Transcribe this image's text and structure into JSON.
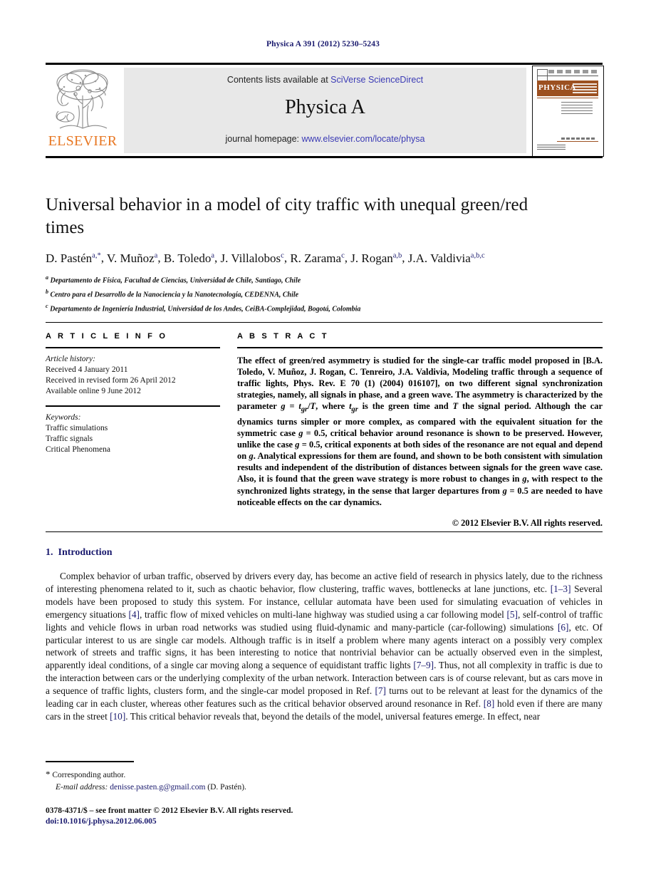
{
  "running_head": "Physica A 391 (2012) 5230–5243",
  "masthead": {
    "contents_prefix": "Contents lists available at ",
    "sciencedirect": "SciVerse ScienceDirect",
    "journal_name": "Physica A",
    "homepage_prefix": "journal homepage: ",
    "homepage_url": "www.elsevier.com/locate/physa",
    "publisher": "ELSEVIER",
    "cover_banner": "PHYSICA",
    "accent_orange": "#E87722",
    "link_blue": "#3b3bb5",
    "cover_band": "#9c5020"
  },
  "article": {
    "title": "Universal behavior in a model of city traffic with unequal green/red times",
    "authors": [
      {
        "name": "D. Pastén",
        "sup": "a,*"
      },
      {
        "name": "V. Muñoz",
        "sup": "a"
      },
      {
        "name": "B. Toledo",
        "sup": "a"
      },
      {
        "name": "J. Villalobos",
        "sup": "c"
      },
      {
        "name": "R. Zarama",
        "sup": "c"
      },
      {
        "name": "J. Rogan",
        "sup": "a,b"
      },
      {
        "name": "J.A. Valdivia",
        "sup": "a,b,c"
      }
    ],
    "affiliations": [
      {
        "mark": "a",
        "text": "Departamento de Física, Facultad de Ciencias, Universidad de Chile, Santiago, Chile"
      },
      {
        "mark": "b",
        "text": "Centro para el Desarrollo de la Nanociencia y la Nanotecnología, CEDENNA, Chile"
      },
      {
        "mark": "c",
        "text": "Departamento de Ingeniería Industrial, Universidad de los Andes, CeiBA-Complejidad, Bogotá, Colombia"
      }
    ]
  },
  "article_info": {
    "heading": "A R T I C L E   I N F O",
    "history_label": "Article history:",
    "history": [
      "Received 4 January 2011",
      "Received in revised form 26 April 2012",
      "Available online 9 June 2012"
    ],
    "keywords_label": "Keywords:",
    "keywords": [
      "Traffic simulations",
      "Traffic signals",
      "Critical Phenomena"
    ]
  },
  "abstract": {
    "heading": "A B S T R A C T",
    "text": "The effect of green/red asymmetry is studied for the single-car traffic model proposed in [B.A. Toledo, V. Muñoz, J. Rogan, C. Tenreiro, J.A. Valdivia, Modeling traffic through a sequence of traffic lights, Phys. Rev. E 70 (1) (2004) 016107], on two different signal synchronization strategies, namely, all signals in phase, and a green wave. The asymmetry is characterized by the parameter g = tgr/T, where tgr is the green time and T the signal period. Although the car dynamics turns simpler or more complex, as compared with the equivalent situation for the symmetric case g = 0.5, critical behavior around resonance is shown to be preserved. However, unlike the case g = 0.5, critical exponents at both sides of the resonance are not equal and depend on g. Analytical expressions for them are found, and shown to be both consistent with simulation results and independent of the distribution of distances between signals for the green wave case. Also, it is found that the green wave strategy is more robust to changes in g, with respect to the synchronized lights strategy, in the sense that larger departures from g = 0.5 are needed to have noticeable effects on the car dynamics.",
    "copyright": "© 2012 Elsevier B.V. All rights reserved."
  },
  "section": {
    "number": "1.",
    "title": "Introduction",
    "paragraph": "Complex behavior of urban traffic, observed by drivers every day, has become an active field of research in physics lately, due to the richness of interesting phenomena related to it, such as chaotic behavior, flow clustering, traffic waves, bottlenecks at lane junctions, etc. [1–3] Several models have been proposed to study this system. For instance, cellular automata have been used for simulating evacuation of vehicles in emergency situations [4], traffic flow of mixed vehicles on multi-lane highway was studied using a car following model [5], self-control of traffic lights and vehicle flows in urban road networks was studied using fluid-dynamic and many-particle (car-following) simulations [6], etc. Of particular interest to us are single car models. Although traffic is in itself a problem where many agents interact on a possibly very complex network of streets and traffic signs, it has been interesting to notice that nontrivial behavior can be actually observed even in the simplest, apparently ideal conditions, of a single car moving along a sequence of equidistant traffic lights [7–9]. Thus, not all complexity in traffic is due to the interaction between cars or the underlying complexity of the urban network. Interaction between cars is of course relevant, but as cars move in a sequence of traffic lights, clusters form, and the single-car model proposed in Ref. [7] turns out to be relevant at least for the dynamics of the leading car in each cluster, whereas other features such as the critical behavior observed around resonance in Ref. [8] hold even if there are many cars in the street [10]. This critical behavior reveals that, beyond the details of the model, universal features emerge. In effect, near"
  },
  "footer": {
    "corresponding_marker": "*",
    "corresponding_text": "Corresponding author.",
    "email_label": "E-mail address:",
    "email": "denisse.pasten.g@gmail.com",
    "email_owner": "(D. Pastén).",
    "front_matter": "0378-4371/$ – see front matter © 2012 Elsevier B.V. All rights reserved.",
    "doi": "doi:10.1016/j.physa.2012.06.005"
  }
}
